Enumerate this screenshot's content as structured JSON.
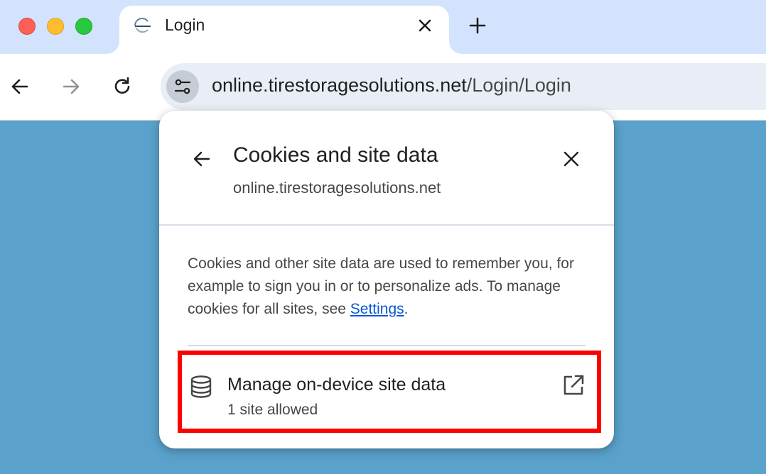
{
  "browser": {
    "tab": {
      "title": "Login"
    },
    "omnibox": {
      "url_host": "online.tirestoragesolutions.net",
      "url_path": "/Login/Login"
    }
  },
  "popup": {
    "title": "Cookies and site data",
    "domain": "online.tirestoragesolutions.net",
    "description_prefix": "Cookies and other site data are used to remember you, for example to sign you in or to personalize ads. To manage cookies for all sites, see ",
    "settings_link": "Settings",
    "description_suffix": ".",
    "manage": {
      "title": "Manage on-device site data",
      "subtitle": "1 site allowed"
    }
  },
  "colors": {
    "tabstrip": "#d3e3fd",
    "page_background": "#5aa2cb",
    "link": "#0b57d0",
    "highlight": "#ff0000"
  },
  "icons": {
    "back": "arrow-left-icon",
    "forward": "arrow-right-icon",
    "reload": "reload-icon",
    "site_info": "tune-icon",
    "close": "close-icon",
    "new_tab": "plus-icon",
    "database": "database-icon",
    "external": "open-in-new-icon"
  }
}
